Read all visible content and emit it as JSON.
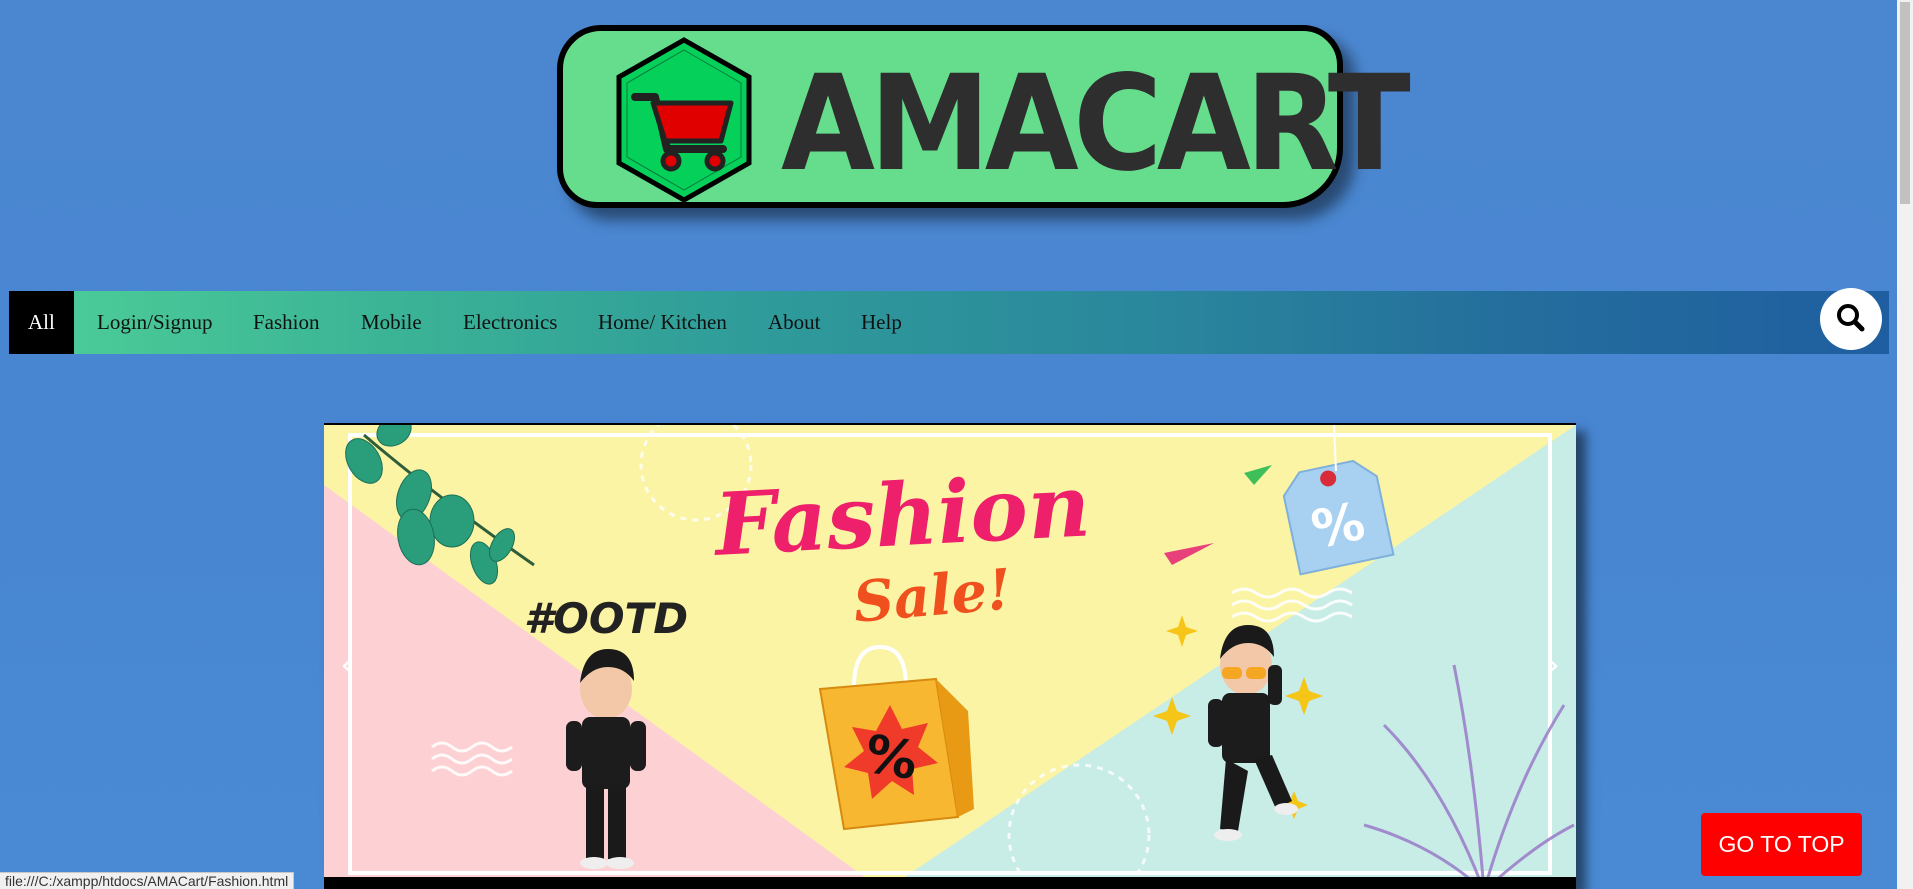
{
  "logo": {
    "text": "AMACART",
    "icon": "shopping-cart-icon"
  },
  "nav": {
    "items": [
      {
        "label": "All",
        "active": true
      },
      {
        "label": "Login/Signup"
      },
      {
        "label": "Fashion"
      },
      {
        "label": "Mobile"
      },
      {
        "label": "Electronics"
      },
      {
        "label": "Home/ Kitchen"
      },
      {
        "label": "About"
      },
      {
        "label": "Help"
      }
    ],
    "search_icon": "search-icon"
  },
  "banner": {
    "title": "Fashion",
    "subtitle": "Sale!",
    "hashtag": "#OOTD",
    "tag_text": "%",
    "bag_text": "%",
    "prev_glyph": "‹",
    "next_glyph": "›"
  },
  "go_top": {
    "label": "GO TO TOP"
  },
  "status": {
    "url": "file:///C:/xampp/htdocs/AMACart/Fashion.html"
  },
  "colors": {
    "background": "#4a86cf",
    "logo_bg": "#66dd8c",
    "nav_start": "#4ecf98",
    "nav_end": "#1f5ea0",
    "go_top": "#ff0000"
  }
}
